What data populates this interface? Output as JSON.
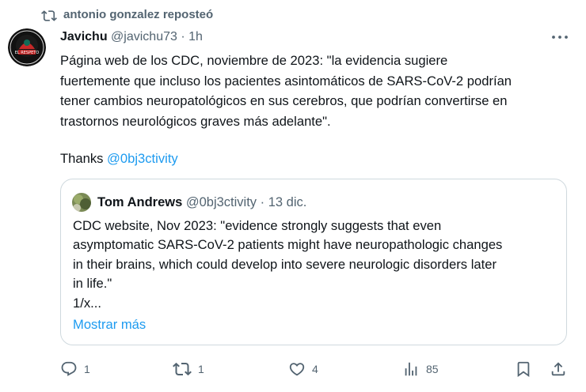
{
  "repost": {
    "label": "antonio gonzalez reposteó",
    "icon": "repost-icon"
  },
  "post": {
    "author_name": "Javichu",
    "author_handle": "@javichu73",
    "separator": "·",
    "time": "1h",
    "avatar_icon": "avatar",
    "more_icon": "more-icon",
    "body_lines": [
      "Página web de los CDC, noviembre de 2023: \"la evidencia sugiere",
      "fuertemente que incluso los pacientes asintomáticos de SARS-CoV-2 podrían",
      "tener cambios neuropatológicos en sus cerebros, que podrían convertirse en",
      "trastornos neurológicos graves más adelante\"."
    ],
    "thanks_prefix": "Thanks ",
    "mention": "@0bj3ctivity"
  },
  "quote": {
    "author_name": "Tom Andrews",
    "author_handle": "@0bj3ctivity",
    "separator": "·",
    "time": "13 dic.",
    "body_lines": [
      "CDC website, Nov 2023: \"evidence strongly suggests that even",
      "asymptomatic SARS-CoV-2 patients might have neuropathologic changes",
      "in their brains, which could develop into severe neurologic disorders later",
      "in life.\"",
      "1/x..."
    ],
    "show_more": "Mostrar más"
  },
  "actions": {
    "reply_count": "1",
    "repost_count": "1",
    "like_count": "4",
    "views_count": "85",
    "icons": [
      "reply-icon",
      "repost-icon",
      "like-icon",
      "views-icon",
      "bookmark-icon",
      "share-icon"
    ]
  },
  "colors": {
    "text": "#0f1419",
    "secondary": "#536471",
    "link": "#1d9bf0",
    "border": "#cfd9de"
  }
}
